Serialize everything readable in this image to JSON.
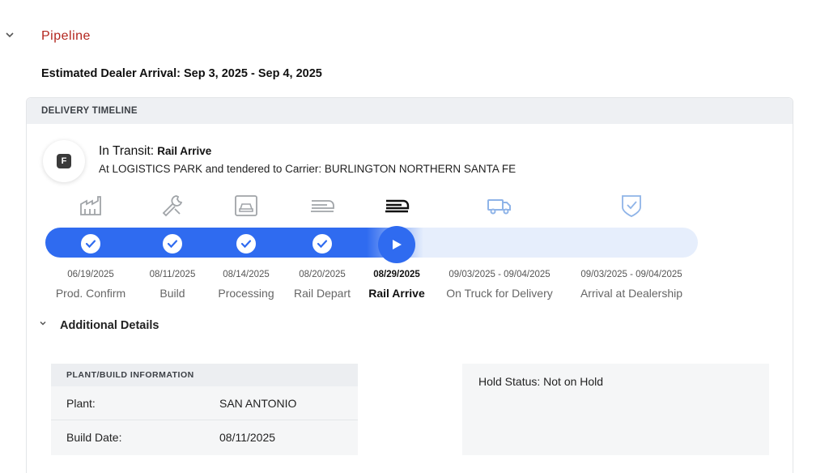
{
  "section": {
    "title": "Pipeline"
  },
  "eta": "Estimated Dealer Arrival: Sep 3, 2025 - Sep 4, 2025",
  "timeline": {
    "header": "DELIVERY TIMELINE",
    "status": {
      "avatar_letter": "F",
      "label": "In Transit:",
      "value": "Rail Arrive",
      "detail": "At LOGISTICS PARK and tendered to Carrier: BURLINGTON NORTHERN SANTA FE"
    },
    "progress_fraction": 0.58,
    "colors": {
      "accent": "#2f6bf0",
      "track": "#e6eefc",
      "pending_icon": "#8fb4e8",
      "done_icon": "#a0a4a8"
    },
    "steps": [
      {
        "date": "06/19/2025",
        "name": "Prod. Confirm",
        "icon": "factory-icon",
        "state": "done"
      },
      {
        "date": "08/11/2025",
        "name": "Build",
        "icon": "wrench-icon",
        "state": "done"
      },
      {
        "date": "08/14/2025",
        "name": "Processing",
        "icon": "car-processing-icon",
        "state": "done"
      },
      {
        "date": "08/20/2025",
        "name": "Rail Depart",
        "icon": "train-icon",
        "state": "done"
      },
      {
        "date": "08/29/2025",
        "name": "Rail Arrive",
        "icon": "train-icon",
        "state": "current"
      },
      {
        "date": "09/03/2025 - 09/04/2025",
        "name": "On Truck for Delivery",
        "icon": "truck-icon",
        "state": "pending"
      },
      {
        "date": "09/03/2025 - 09/04/2025",
        "name": "Arrival at Dealership",
        "icon": "shield-check-icon",
        "state": "pending"
      }
    ]
  },
  "details": {
    "title": "Additional Details",
    "plant": {
      "header": "PLANT/BUILD INFORMATION",
      "rows": [
        {
          "label": "Plant:",
          "value": "SAN ANTONIO"
        },
        {
          "label": "Build Date:",
          "value": "08/11/2025"
        }
      ]
    },
    "hold": {
      "text": "Hold Status: Not on Hold"
    }
  }
}
